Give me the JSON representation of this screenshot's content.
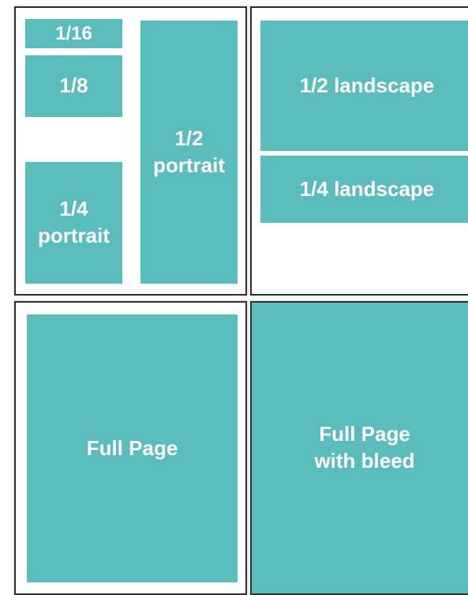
{
  "colors": {
    "block_fill": "#5bbcbc",
    "border": "#2e2e2e",
    "label_text": "#ffffff"
  },
  "ad_sizes": {
    "sixteenth": "1/16",
    "eighth": "1/8",
    "quarter_portrait": "1/4\nportrait",
    "half_portrait": "1/2\nportrait",
    "half_landscape": "1/2 landscape",
    "quarter_landscape": "1/4 landscape",
    "full_page": "Full Page",
    "full_page_bleed": "Full Page\nwith bleed"
  }
}
